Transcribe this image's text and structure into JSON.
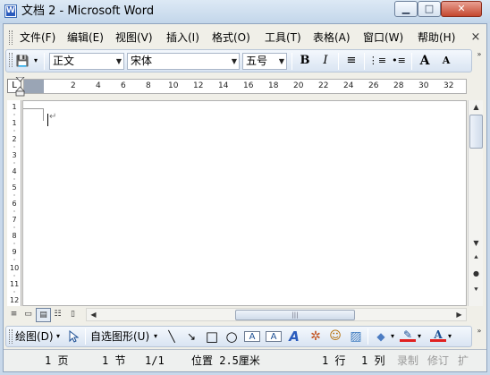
{
  "window": {
    "title": "文档 2 - Microsoft Word",
    "app_icon": "W",
    "minimize_icon": "▁",
    "maximize_icon": "□",
    "close_icon": "✕"
  },
  "menu": {
    "items": [
      "文件(F)",
      "编辑(E)",
      "视图(V)",
      "插入(I)",
      "格式(O)",
      "工具(T)",
      "表格(A)",
      "窗口(W)",
      "帮助(H)"
    ],
    "close_icon": "×"
  },
  "toolbar": {
    "save_icon": "💾",
    "style_value": "正文",
    "font_value": "宋体",
    "size_value": "五号",
    "bold_label": "B",
    "italic_label": "I",
    "align_icon": "≡",
    "numbering_icon": "⋮≡",
    "bullets_icon": "•≡",
    "grow_font_label": "A",
    "shrink_font_label": "A",
    "overflow_icon": "»"
  },
  "ruler": {
    "corner_icon": "L",
    "ticks": [
      "2",
      "4",
      "6",
      "8",
      "10",
      "12",
      "14",
      "16",
      "18",
      "20",
      "22",
      "24",
      "26",
      "28",
      "30",
      "32"
    ],
    "vticks": [
      "1",
      "·",
      "1",
      "·",
      "2",
      "·",
      "3",
      "·",
      "4",
      "·",
      "5",
      "·",
      "6",
      "·",
      "7",
      "·",
      "8",
      "·",
      "9",
      "·",
      "10",
      "·",
      "11",
      "·",
      "12"
    ]
  },
  "document": {
    "paragraph_mark": "↵"
  },
  "scrollbars": {
    "up": "▲",
    "down": "▼",
    "left": "◀",
    "right": "▶",
    "prev_page": "⯅",
    "select_browse": "●",
    "next_page": "⯆",
    "hthumb_grip": "|||"
  },
  "view_buttons": [
    "≡",
    "▭",
    "▤",
    "☷",
    "▯"
  ],
  "drawing": {
    "draw_label": "绘图(D)",
    "autoshape_label": "自选图形(U)",
    "line_icon": "╲",
    "arrow_icon": "↘",
    "rect_icon": "□",
    "oval_icon": "○",
    "textbox_icon": "A",
    "vtextbox_icon": "A",
    "wordart_icon": "A",
    "diagram_icon": "✲",
    "clipart_icon": "☺",
    "picture_icon": "▨",
    "fill_icon": "◆",
    "linecolor_icon": "✎",
    "fontcolor_label": "A",
    "overflow_icon": "»"
  },
  "status": {
    "page": "1 页",
    "section": "1 节",
    "page_of": "1/1",
    "position": "位置 2.5厘米",
    "line": "1 行",
    "column": "1 列",
    "rec": "录制",
    "trk": "修订",
    "ext": "扩"
  }
}
